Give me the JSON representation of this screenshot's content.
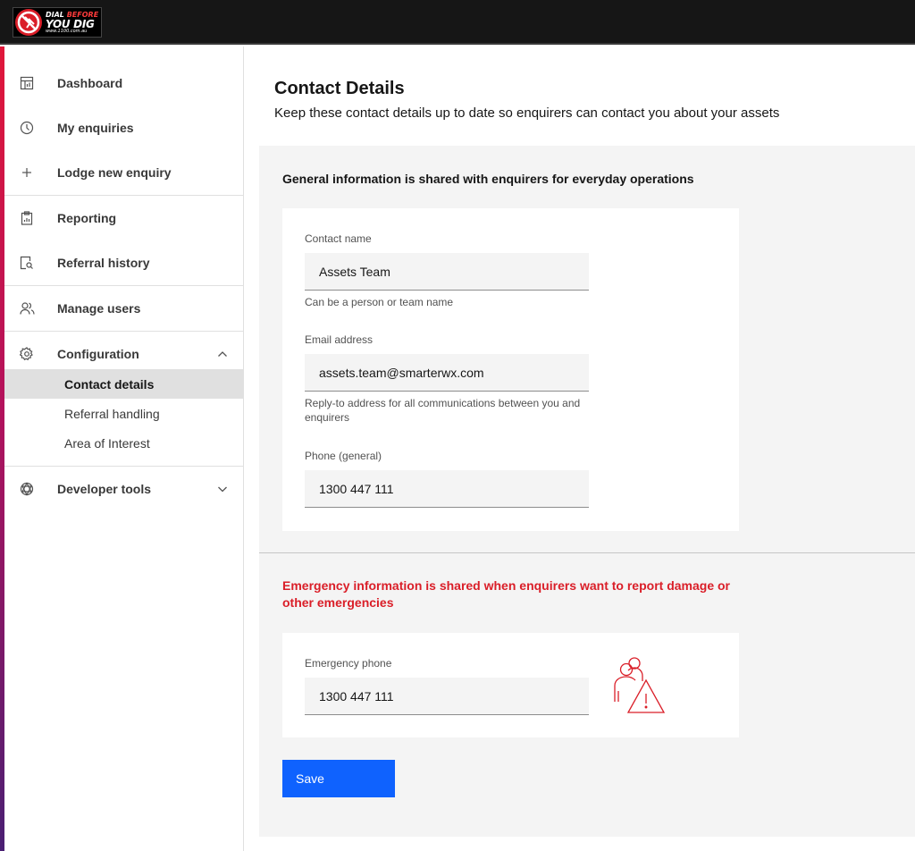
{
  "brand": {
    "logo_line1_a": "DIAL ",
    "logo_line1_b": "BEFORE",
    "logo_line2": "YOU DIG",
    "logo_line3": "www.1100.com.au"
  },
  "colors": {
    "header_bg": "#161616",
    "accent": "#da1e28",
    "primary": "#0f62fe",
    "emergency_text": "#da1e28"
  },
  "sidebar": {
    "items": [
      {
        "label": "Dashboard",
        "icon": "dashboard-icon"
      },
      {
        "label": "My enquiries",
        "icon": "clock-icon"
      },
      {
        "label": "Lodge new enquiry",
        "icon": "plus-icon"
      },
      {
        "label": "Reporting",
        "icon": "clipboard-icon"
      },
      {
        "label": "Referral history",
        "icon": "document-search-icon"
      },
      {
        "label": "Manage users",
        "icon": "users-icon"
      },
      {
        "label": "Configuration",
        "icon": "gear-icon",
        "expanded": true
      },
      {
        "label": "Developer tools",
        "icon": "developer-icon",
        "expanded": false
      }
    ],
    "config_subitems": [
      {
        "label": "Contact details",
        "active": true
      },
      {
        "label": "Referral handling",
        "active": false
      },
      {
        "label": "Area of Interest",
        "active": false
      }
    ]
  },
  "main": {
    "title": "Contact Details",
    "subtitle": "Keep these contact details up to date so enquirers can contact you about your assets",
    "general": {
      "heading": "General information is shared with enquirers for everyday operations",
      "contact_name": {
        "label": "Contact name",
        "value": "Assets Team",
        "helper": "Can be a person or team name"
      },
      "email": {
        "label": "Email address",
        "value": "assets.team@smarterwx.com",
        "helper": "Reply-to address for all communications between you and enquirers"
      },
      "phone": {
        "label": "Phone (general)",
        "value": "1300 447 111"
      }
    },
    "emergency": {
      "heading": "Emergency information is shared when enquirers want to report damage or other emergencies",
      "phone": {
        "label": "Emergency phone",
        "value": "1300 447 111"
      },
      "illustration": "people-warning-icon"
    },
    "save_label": "Save"
  }
}
